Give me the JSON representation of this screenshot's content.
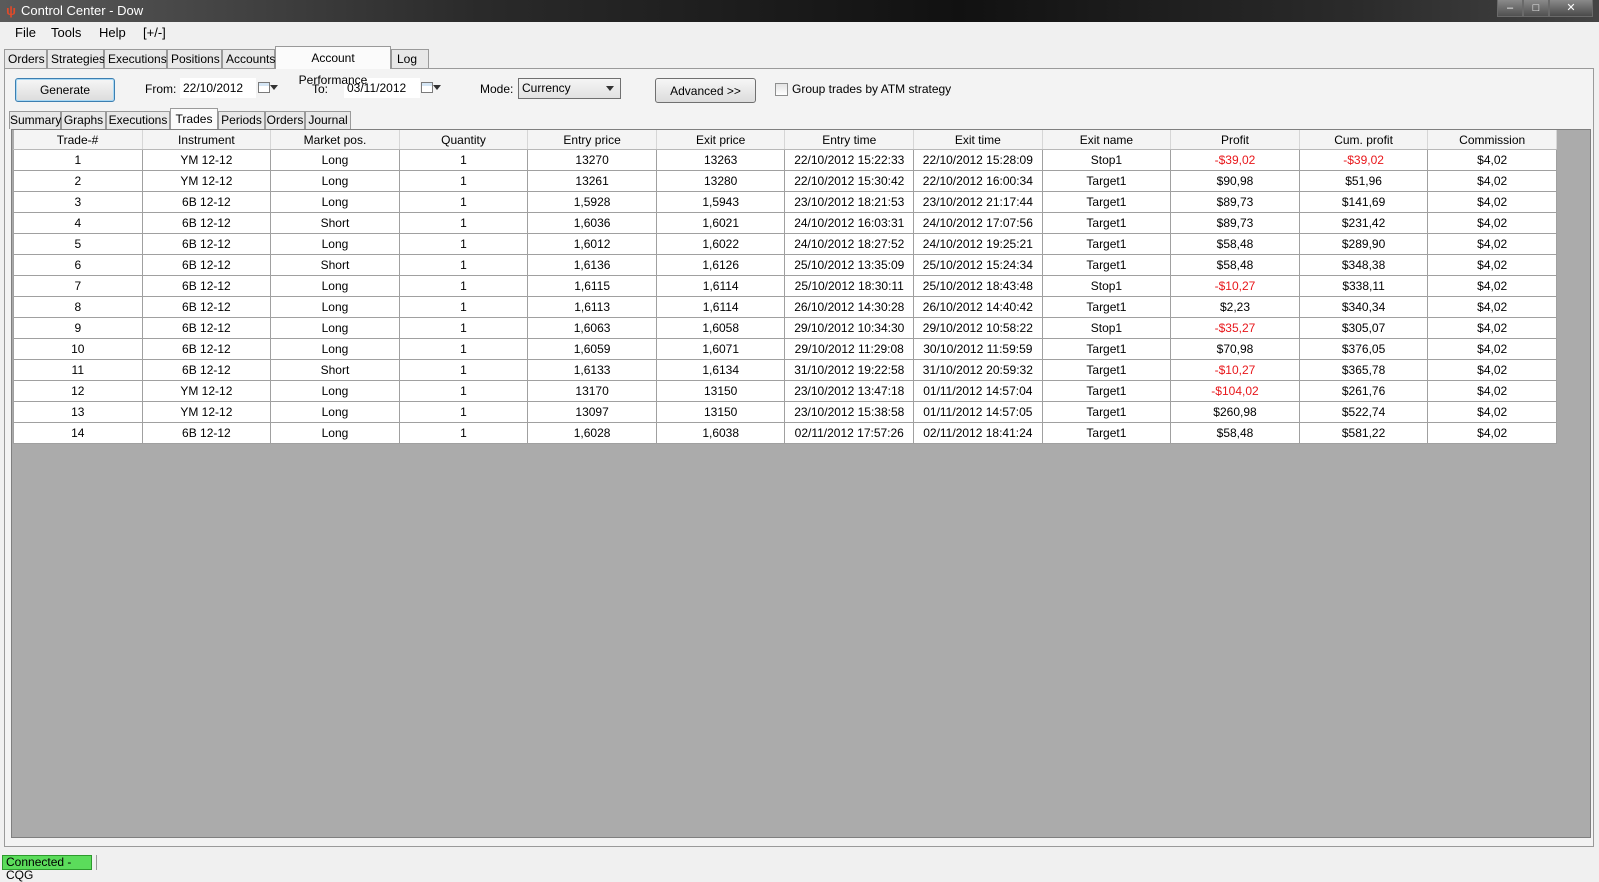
{
  "window": {
    "title": "Control Center - Dow",
    "min_label": "–",
    "max_label": "□",
    "close_label": "✕"
  },
  "menu": {
    "items": [
      "File",
      "Tools",
      "Help",
      "[+/-]"
    ]
  },
  "top_tabs": [
    "Orders",
    "Strategies",
    "Executions",
    "Positions",
    "Accounts",
    "Account Performance",
    "Log"
  ],
  "toolbar": {
    "generate_label": "Generate",
    "from_label": "From:",
    "from_value": "22/10/2012",
    "to_label": "To:",
    "to_value": "03/11/2012",
    "mode_label": "Mode:",
    "mode_value": "Currency",
    "advanced_label": "Advanced >>",
    "group_trades_label": "Group trades by ATM strategy",
    "group_trades_checked": false
  },
  "sub_tabs": [
    "Summary",
    "Graphs",
    "Executions",
    "Trades",
    "Periods",
    "Orders",
    "Journal"
  ],
  "trades": {
    "columns": [
      "Trade-#",
      "Instrument",
      "Market pos.",
      "Quantity",
      "Entry price",
      "Exit price",
      "Entry time",
      "Exit time",
      "Exit name",
      "Profit",
      "Cum. profit",
      "Commission"
    ],
    "rows": [
      [
        "1",
        "YM 12-12",
        "Long",
        "1",
        "13270",
        "13263",
        "22/10/2012 15:22:33",
        "22/10/2012 15:28:09",
        "Stop1",
        "-$39,02",
        "-$39,02",
        "$4,02"
      ],
      [
        "2",
        "YM 12-12",
        "Long",
        "1",
        "13261",
        "13280",
        "22/10/2012 15:30:42",
        "22/10/2012 16:00:34",
        "Target1",
        "$90,98",
        "$51,96",
        "$4,02"
      ],
      [
        "3",
        "6B 12-12",
        "Long",
        "1",
        "1,5928",
        "1,5943",
        "23/10/2012 18:21:53",
        "23/10/2012 21:17:44",
        "Target1",
        "$89,73",
        "$141,69",
        "$4,02"
      ],
      [
        "4",
        "6B 12-12",
        "Short",
        "1",
        "1,6036",
        "1,6021",
        "24/10/2012 16:03:31",
        "24/10/2012 17:07:56",
        "Target1",
        "$89,73",
        "$231,42",
        "$4,02"
      ],
      [
        "5",
        "6B 12-12",
        "Long",
        "1",
        "1,6012",
        "1,6022",
        "24/10/2012 18:27:52",
        "24/10/2012 19:25:21",
        "Target1",
        "$58,48",
        "$289,90",
        "$4,02"
      ],
      [
        "6",
        "6B 12-12",
        "Short",
        "1",
        "1,6136",
        "1,6126",
        "25/10/2012 13:35:09",
        "25/10/2012 15:24:34",
        "Target1",
        "$58,48",
        "$348,38",
        "$4,02"
      ],
      [
        "7",
        "6B 12-12",
        "Long",
        "1",
        "1,6115",
        "1,6114",
        "25/10/2012 18:30:11",
        "25/10/2012 18:43:48",
        "Stop1",
        "-$10,27",
        "$338,11",
        "$4,02"
      ],
      [
        "8",
        "6B 12-12",
        "Long",
        "1",
        "1,6113",
        "1,6114",
        "26/10/2012 14:30:28",
        "26/10/2012 14:40:42",
        "Target1",
        "$2,23",
        "$340,34",
        "$4,02"
      ],
      [
        "9",
        "6B 12-12",
        "Long",
        "1",
        "1,6063",
        "1,6058",
        "29/10/2012 10:34:30",
        "29/10/2012 10:58:22",
        "Stop1",
        "-$35,27",
        "$305,07",
        "$4,02"
      ],
      [
        "10",
        "6B 12-12",
        "Long",
        "1",
        "1,6059",
        "1,6071",
        "29/10/2012 11:29:08",
        "30/10/2012 11:59:59",
        "Target1",
        "$70,98",
        "$376,05",
        "$4,02"
      ],
      [
        "11",
        "6B 12-12",
        "Short",
        "1",
        "1,6133",
        "1,6134",
        "31/10/2012 19:22:58",
        "31/10/2012 20:59:32",
        "Target1",
        "-$10,27",
        "$365,78",
        "$4,02"
      ],
      [
        "12",
        "YM 12-12",
        "Long",
        "1",
        "13170",
        "13150",
        "23/10/2012 13:47:18",
        "01/11/2012 14:57:04",
        "Target1",
        "-$104,02",
        "$261,76",
        "$4,02"
      ],
      [
        "13",
        "YM 12-12",
        "Long",
        "1",
        "13097",
        "13150",
        "23/10/2012 15:38:58",
        "01/11/2012 14:57:05",
        "Target1",
        "$260,98",
        "$522,74",
        "$4,02"
      ],
      [
        "14",
        "6B 12-12",
        "Long",
        "1",
        "1,6028",
        "1,6038",
        "02/11/2012 17:57:26",
        "02/11/2012 18:41:24",
        "Target1",
        "$58,48",
        "$581,22",
        "$4,02"
      ]
    ]
  },
  "status": {
    "connection": "Connected - CQG",
    "connection_color": "#5bdc5b"
  },
  "colors": {
    "negative": "#e8171b"
  }
}
